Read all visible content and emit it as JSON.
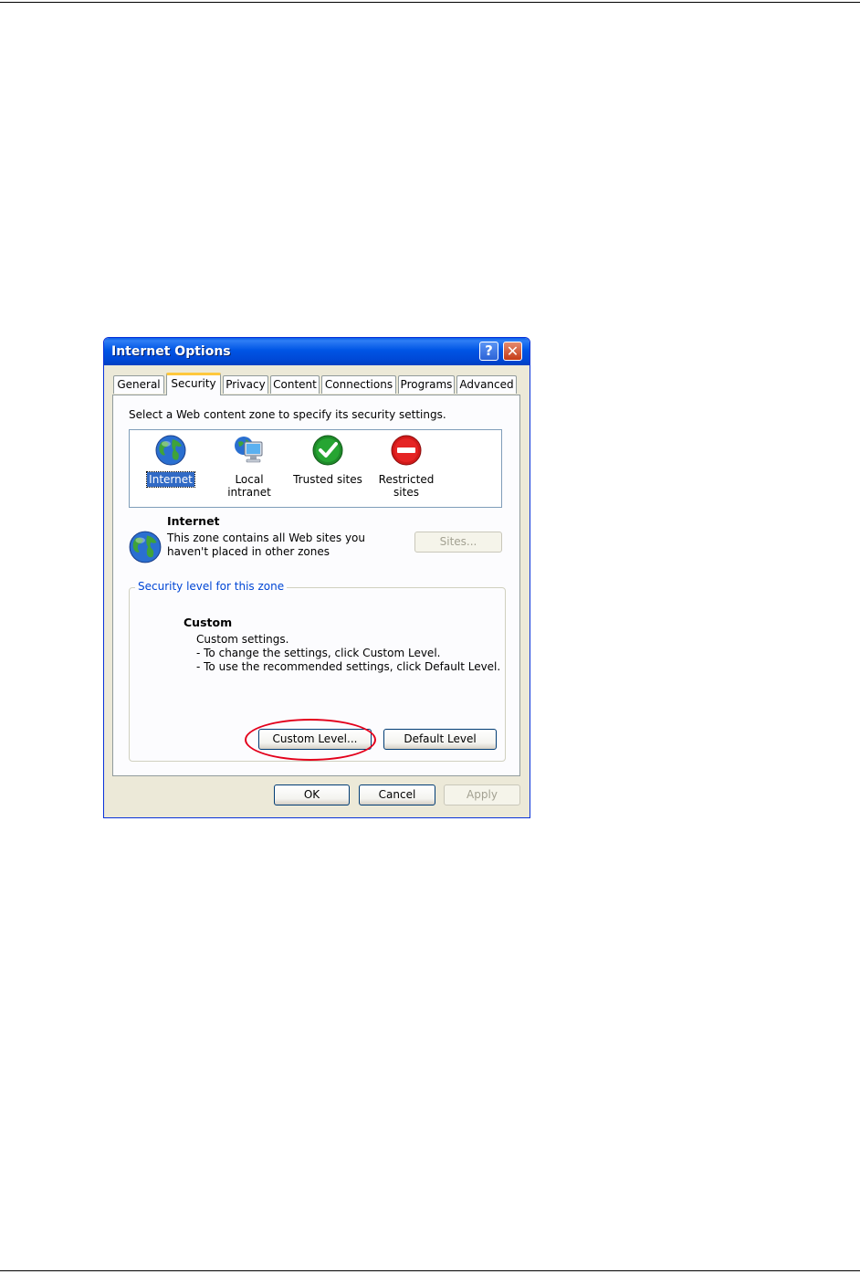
{
  "dialog": {
    "title": "Internet Options",
    "help_symbol": "?",
    "close_symbol": "✕"
  },
  "tabs": [
    {
      "label": "General"
    },
    {
      "label": "Security",
      "active": true
    },
    {
      "label": "Privacy"
    },
    {
      "label": "Content"
    },
    {
      "label": "Connections"
    },
    {
      "label": "Programs"
    },
    {
      "label": "Advanced"
    }
  ],
  "security": {
    "intro": "Select a Web content zone to specify its security settings.",
    "zones": [
      {
        "label": "Internet",
        "icon": "globe-icon",
        "selected": true
      },
      {
        "label": "Local intranet",
        "icon": "monitor-globe-icon"
      },
      {
        "label": "Trusted sites",
        "icon": "check-icon"
      },
      {
        "label": "Restricted sites",
        "icon": "no-entry-icon"
      }
    ],
    "selected_zone": {
      "name": "Internet",
      "desc_line1": "This zone contains all Web sites you",
      "desc_line2": "haven't placed in other zones"
    },
    "sites_button": "Sites...",
    "group_label": "Security level for this zone",
    "level": {
      "name": "Custom",
      "line1": "Custom settings.",
      "line2": "- To change the settings, click Custom Level.",
      "line3": "- To use the recommended settings, click Default Level."
    },
    "custom_level_button": "Custom Level...",
    "default_level_button": "Default Level"
  },
  "footer": {
    "ok": "OK",
    "cancel": "Cancel",
    "apply": "Apply"
  },
  "colors": {
    "titlebar": "#0055e5",
    "dialog_bg": "#ece9d8",
    "selection": "#316ac5",
    "annotation_ring": "#e3001b"
  }
}
